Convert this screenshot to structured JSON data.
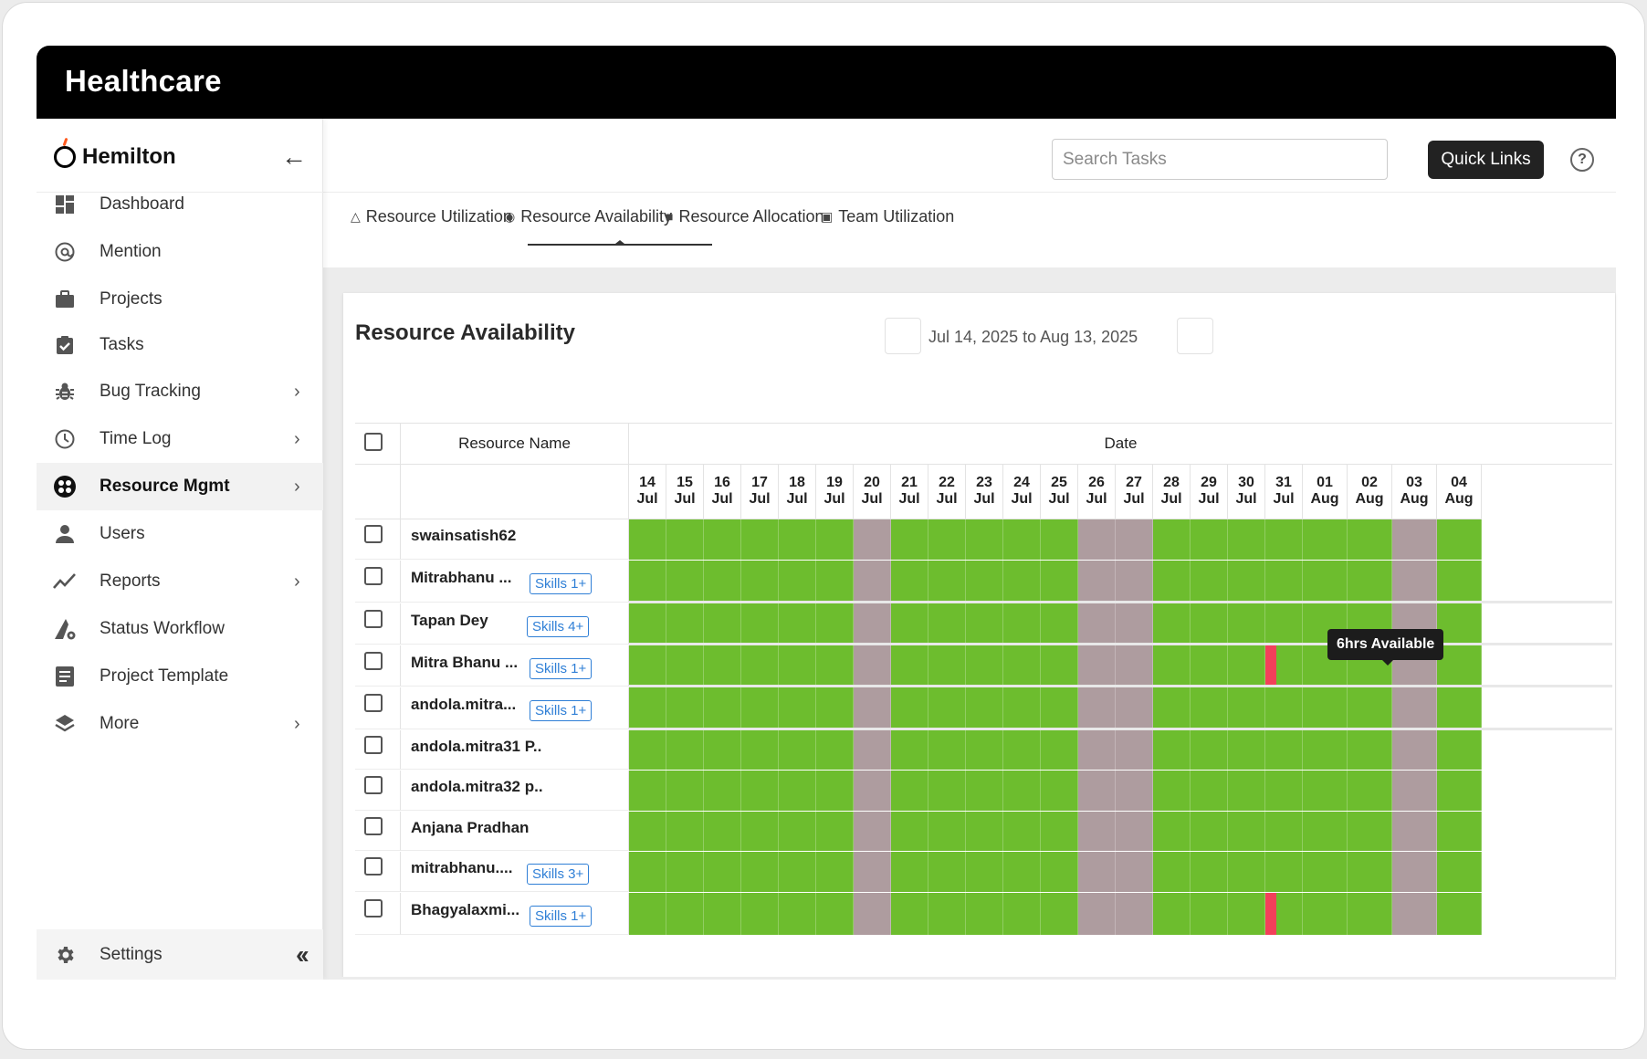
{
  "window": {
    "title": "Healthcare"
  },
  "brand": {
    "name": "Hemilton"
  },
  "sidebar": {
    "items": [
      {
        "label": "Dashboard",
        "icon": "dashboard-icon",
        "chevron": false
      },
      {
        "label": "Mention",
        "icon": "at-icon",
        "chevron": false
      },
      {
        "label": "Projects",
        "icon": "briefcase-icon",
        "chevron": false
      },
      {
        "label": "Tasks",
        "icon": "clipboard-check-icon",
        "chevron": false
      },
      {
        "label": "Bug Tracking",
        "icon": "bug-icon",
        "chevron": true
      },
      {
        "label": "Time Log",
        "icon": "clock-icon",
        "chevron": true
      },
      {
        "label": "Resource Mgmt",
        "icon": "resource-icon",
        "chevron": true,
        "active": true
      },
      {
        "label": "Users",
        "icon": "user-icon",
        "chevron": false
      },
      {
        "label": "Reports",
        "icon": "trend-icon",
        "chevron": true
      },
      {
        "label": "Status Workflow",
        "icon": "workflow-icon",
        "chevron": false
      },
      {
        "label": "Project Template",
        "icon": "document-icon",
        "chevron": false
      },
      {
        "label": "More",
        "icon": "layers-icon",
        "chevron": true
      }
    ],
    "settings_label": "Settings"
  },
  "topbar": {
    "search_placeholder": "Search Tasks",
    "quick_links_label": "Quick Links",
    "help_glyph": "?"
  },
  "tabs": [
    {
      "label": "Resource Utilization",
      "icon": "hierarchy-icon"
    },
    {
      "label": "Resource Availability",
      "icon": "people-icon",
      "active": true
    },
    {
      "label": "Resource Allocation",
      "icon": "badge-icon"
    },
    {
      "label": "Team Utilization",
      "icon": "save-icon"
    }
  ],
  "availability": {
    "title": "Resource Availability",
    "date_range": "Jul 14, 2025 to Aug 13, 2025",
    "headers": {
      "resource_name": "Resource Name",
      "date": "Date"
    },
    "days": [
      {
        "day": "14",
        "month": "Jul",
        "weekend": false
      },
      {
        "day": "15",
        "month": "Jul",
        "weekend": false
      },
      {
        "day": "16",
        "month": "Jul",
        "weekend": false
      },
      {
        "day": "17",
        "month": "Jul",
        "weekend": false
      },
      {
        "day": "18",
        "month": "Jul",
        "weekend": false
      },
      {
        "day": "19",
        "month": "Jul",
        "weekend": false
      },
      {
        "day": "20",
        "month": "Jul",
        "weekend": true
      },
      {
        "day": "21",
        "month": "Jul",
        "weekend": false
      },
      {
        "day": "22",
        "month": "Jul",
        "weekend": false
      },
      {
        "day": "23",
        "month": "Jul",
        "weekend": false
      },
      {
        "day": "24",
        "month": "Jul",
        "weekend": false
      },
      {
        "day": "25",
        "month": "Jul",
        "weekend": false
      },
      {
        "day": "26",
        "month": "Jul",
        "weekend": true
      },
      {
        "day": "27",
        "month": "Jul",
        "weekend": true
      },
      {
        "day": "28",
        "month": "Jul",
        "weekend": false
      },
      {
        "day": "29",
        "month": "Jul",
        "weekend": false
      },
      {
        "day": "30",
        "month": "Jul",
        "weekend": false
      },
      {
        "day": "31",
        "month": "Jul",
        "weekend": false
      },
      {
        "day": "01",
        "month": "Aug",
        "weekend": false
      },
      {
        "day": "02",
        "month": "Aug",
        "weekend": false
      },
      {
        "day": "03",
        "month": "Aug",
        "weekend": true
      },
      {
        "day": "04",
        "month": "Aug",
        "weekend": false
      }
    ],
    "resources": [
      {
        "name": "swainsatish62",
        "skills": ""
      },
      {
        "name": "Mitrabhanu ...",
        "skills": "Skills 1+"
      },
      {
        "name": "Tapan Dey",
        "skills": "Skills 4+"
      },
      {
        "name": "Mitra Bhanu ...",
        "skills": "Skills 1+",
        "partial_day": "31"
      },
      {
        "name": "andola.mitra...",
        "skills": "Skills 1+"
      },
      {
        "name": "andola.mitra31 P..",
        "skills": ""
      },
      {
        "name": "andola.mitra32 p..",
        "skills": ""
      },
      {
        "name": "Anjana Pradhan",
        "skills": ""
      },
      {
        "name": "mitrabhanu....",
        "skills": "Skills 3+"
      },
      {
        "name": "Bhagyalaxmi...",
        "skills": "Skills 1+",
        "partial_day": "31"
      }
    ],
    "tooltip": "6hrs Available",
    "colors": {
      "available": "#6dbd2e",
      "weekend": "#ae9c9f",
      "busy": "#f2405a"
    }
  }
}
